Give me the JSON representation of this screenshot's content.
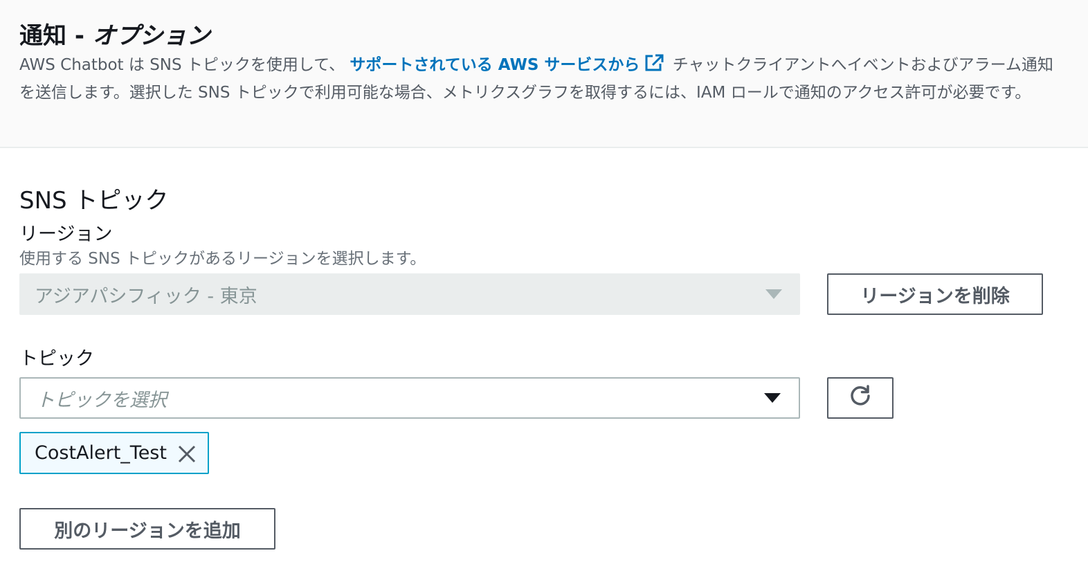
{
  "header": {
    "title_prefix": "通知 - ",
    "title_italic": "オプション",
    "desc_before_link": "AWS Chatbot は SNS トピックを使用して、 ",
    "desc_link": "サポートされている AWS サービスから",
    "desc_after_link": " チャットクライアントへイベントおよびアラーム通知を送信します。選択した SNS トピックで利用可能な場合、メトリクスグラフを取得するには、IAM ロールで通知のアクセス許可が必要です。"
  },
  "sns_section": {
    "title": "SNS トピック",
    "region_label": "リージョン",
    "region_desc": "使用する SNS トピックがあるリージョンを選択します。",
    "region_value": "アジアパシフィック - 東京",
    "remove_region_label": "リージョンを削除",
    "topic_label": "トピック",
    "topic_placeholder": "トピックを選択",
    "selected_topics": [
      "CostAlert_Test"
    ],
    "add_region_label": "別のリージョンを追加"
  },
  "colors": {
    "link": "#0073bb",
    "token_border": "#00a1c9",
    "token_background": "#f1faff"
  },
  "icons": [
    "external-link-icon",
    "caret-down-icon",
    "refresh-icon",
    "close-icon"
  ]
}
